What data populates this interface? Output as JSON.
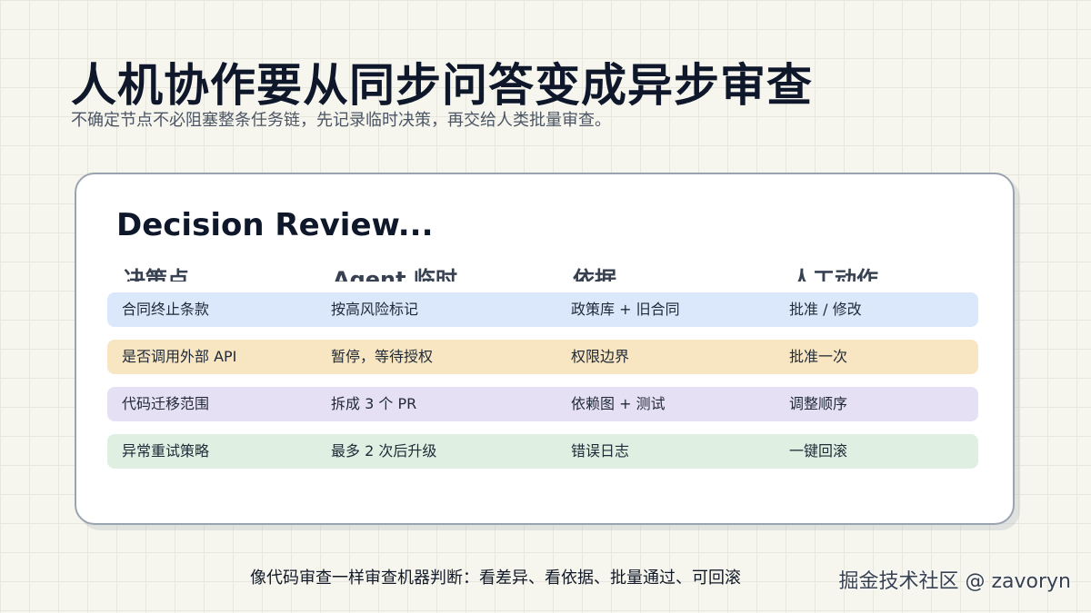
{
  "page": {
    "title": "人机协作要从同步问答变成异步审查",
    "subtitle": "不确定节点不必阻塞整条任务链，先记录临时决策，再交给人类批量审查。"
  },
  "card": {
    "title": "Decision Review...",
    "headers": [
      "决策点",
      "Agent 临时...",
      "依据",
      "人工动作"
    ],
    "rows": [
      {
        "cells": [
          "合同终止条款",
          "按高风险标记",
          "政策库 + 旧合同",
          "批准 / 修改"
        ],
        "color": "#dbe8fb"
      },
      {
        "cells": [
          "是否调用外部 API",
          "暂停，等待授权",
          "权限边界",
          "批准一次"
        ],
        "color": "#f8e6c2"
      },
      {
        "cells": [
          "代码迁移范围",
          "拆成 3 个 PR",
          "依赖图 + 测试",
          "调整顺序"
        ],
        "color": "#e6e0f4"
      },
      {
        "cells": [
          "异常重试策略",
          "最多 2 次后升级",
          "错误日志",
          "一键回滚"
        ],
        "color": "#dff0e3"
      }
    ]
  },
  "footer": {
    "text": "像代码审查一样审查机器判断：看差异、看依据、批量通过、可回滚",
    "watermark": "掘金技术社区 @ zavoryn"
  }
}
